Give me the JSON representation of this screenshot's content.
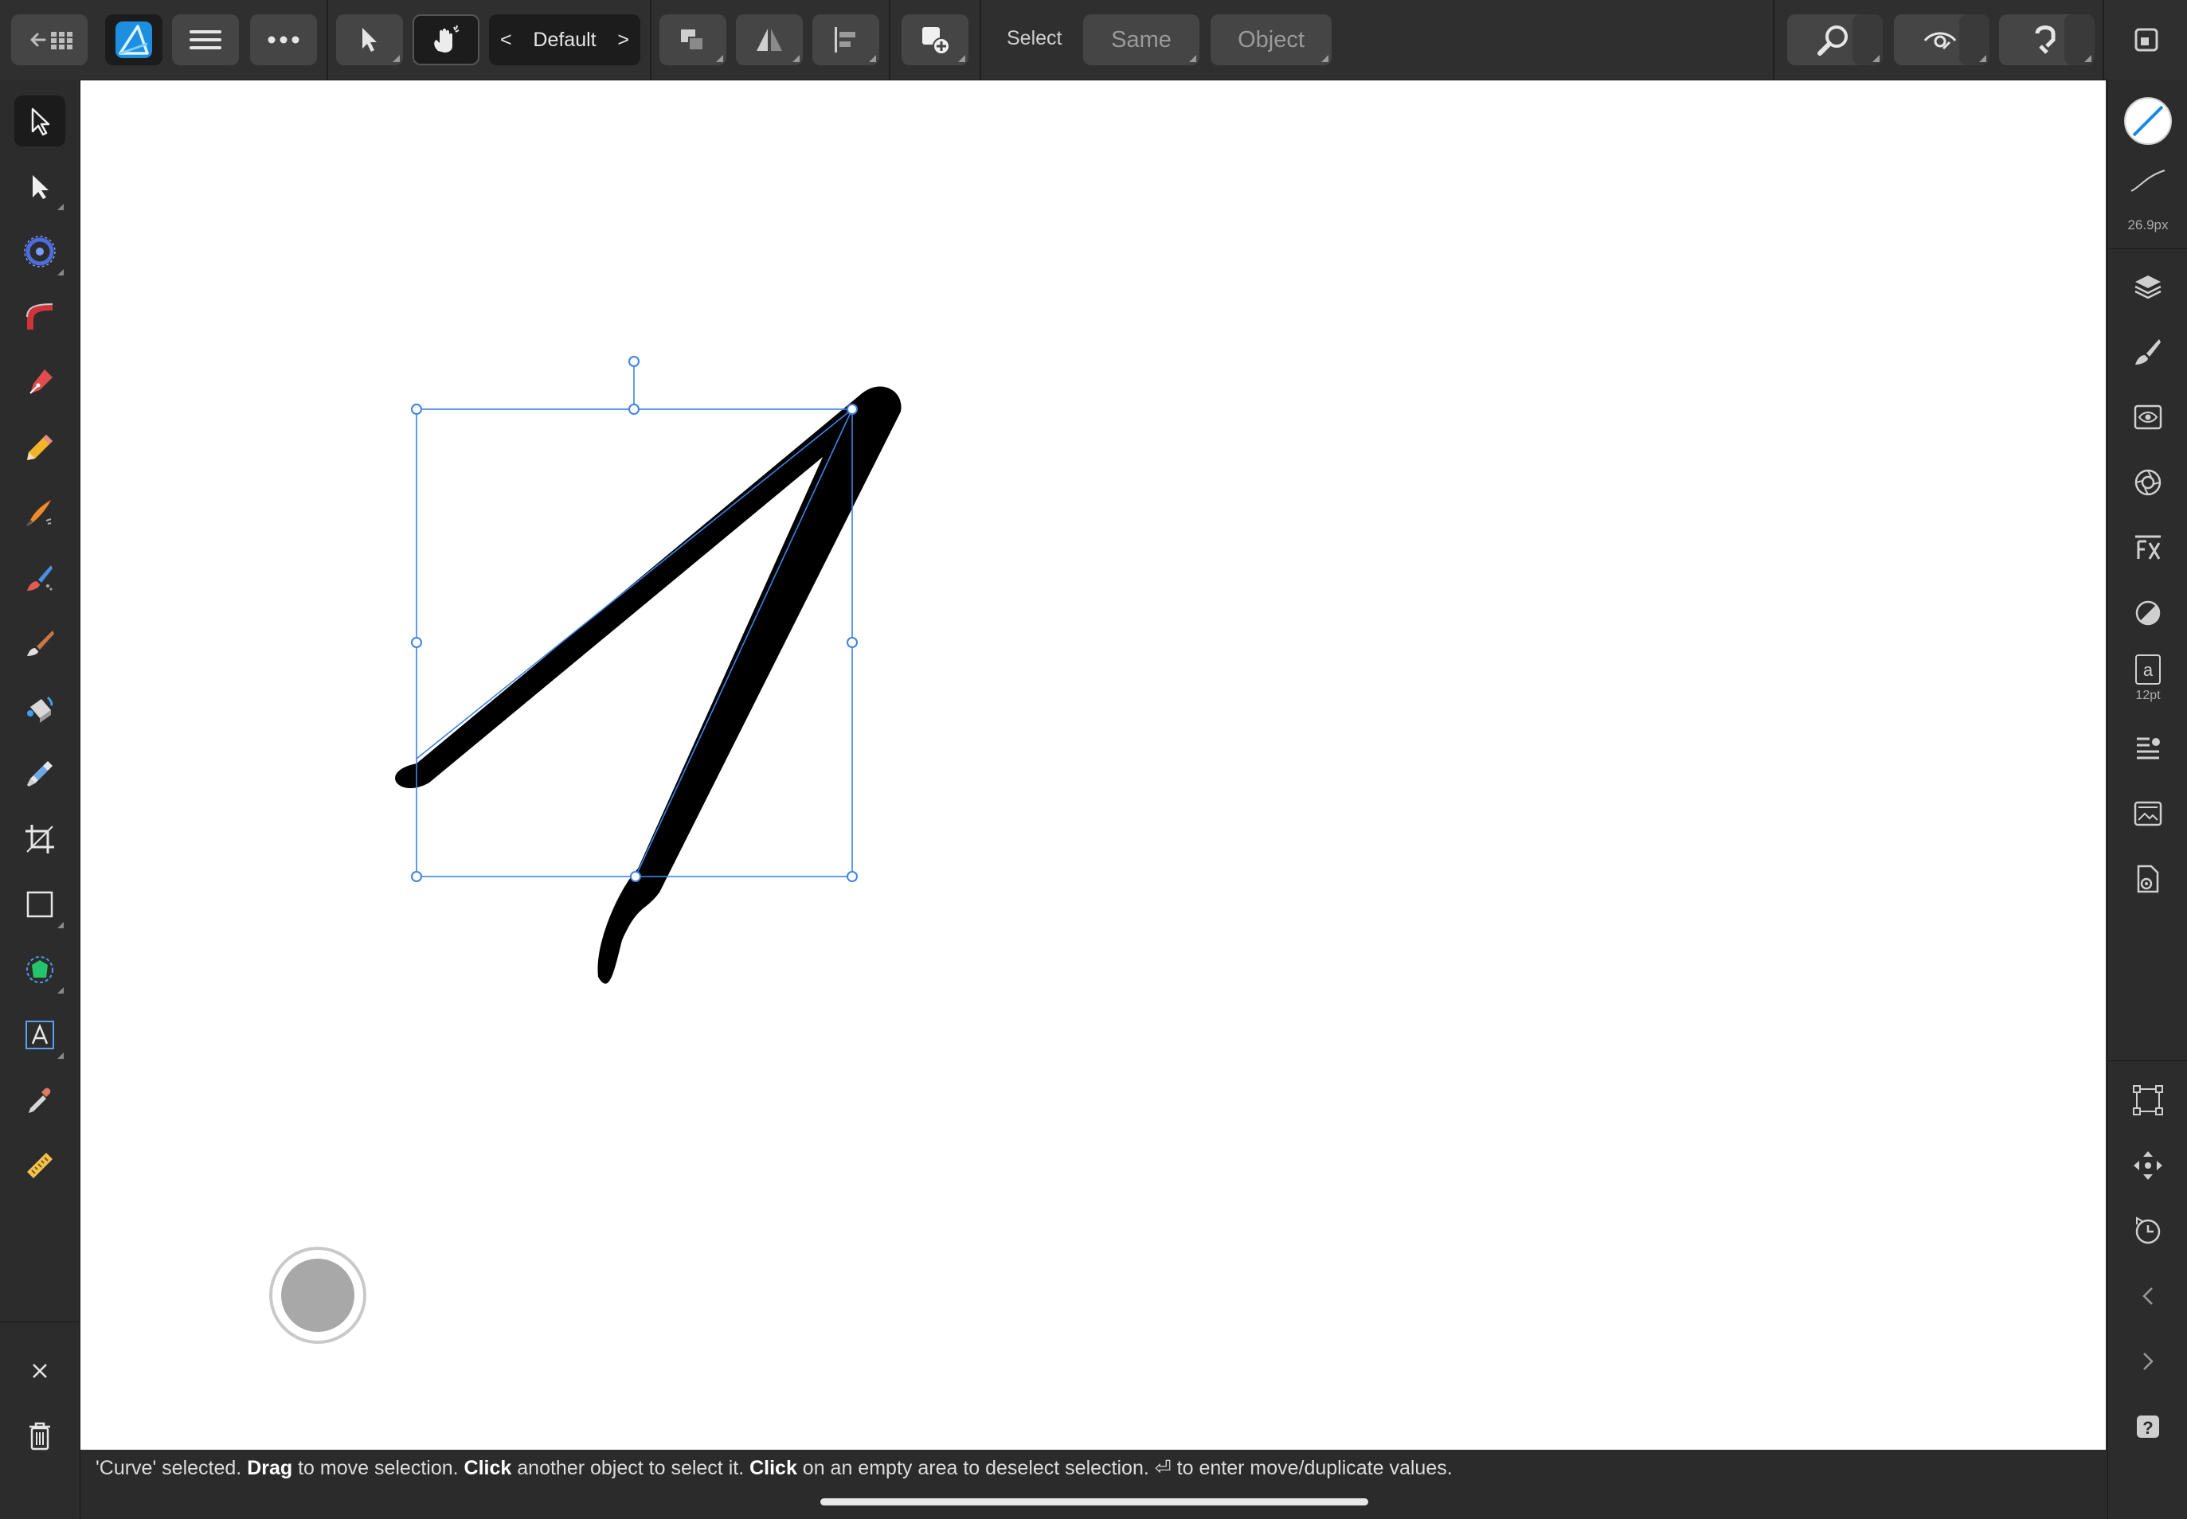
{
  "toolbar": {
    "back_icon": "back-grid-icon",
    "app_icon": "affinity-designer-icon",
    "menu_icon": "hamburger-menu-icon",
    "more_icon": "ellipsis-icon",
    "persona": {
      "prev": "<",
      "label": "Default",
      "next": ">"
    },
    "select_label": "Select",
    "same_label": "Same",
    "object_label": "Object"
  },
  "tools": [
    {
      "name": "move-tool"
    },
    {
      "name": "node-tool"
    },
    {
      "name": "point-transform-tool"
    },
    {
      "name": "corner-tool"
    },
    {
      "name": "pen-tool"
    },
    {
      "name": "pencil-tool"
    },
    {
      "name": "vector-brush-tool"
    },
    {
      "name": "paint-brush-tool"
    },
    {
      "name": "brush-tool"
    },
    {
      "name": "fill-tool"
    },
    {
      "name": "transparency-tool"
    },
    {
      "name": "crop-tool"
    },
    {
      "name": "rectangle-tool"
    },
    {
      "name": "shape-builder-tool"
    },
    {
      "name": "artistic-text-tool"
    },
    {
      "name": "color-picker-tool"
    },
    {
      "name": "measure-tool"
    }
  ],
  "right_panel": {
    "stroke_width": "26.9px",
    "font_size": "12pt"
  },
  "status": {
    "segments": [
      {
        "t": "'Curve' selected. ",
        "b": false
      },
      {
        "t": "Drag",
        "b": true
      },
      {
        "t": " to move selection. ",
        "b": false
      },
      {
        "t": "Click",
        "b": true
      },
      {
        "t": " another object to select it. ",
        "b": false
      },
      {
        "t": "Click",
        "b": true
      },
      {
        "t": " on an empty area to deselect selection. ",
        "b": false
      },
      {
        "t": "⏎",
        "b": false
      },
      {
        "t": " to enter move/duplicate values.",
        "b": false
      }
    ]
  },
  "colors": {
    "selection": "#3d84e5",
    "stroke": "#000000",
    "accent_app": "#1ea7f2"
  }
}
